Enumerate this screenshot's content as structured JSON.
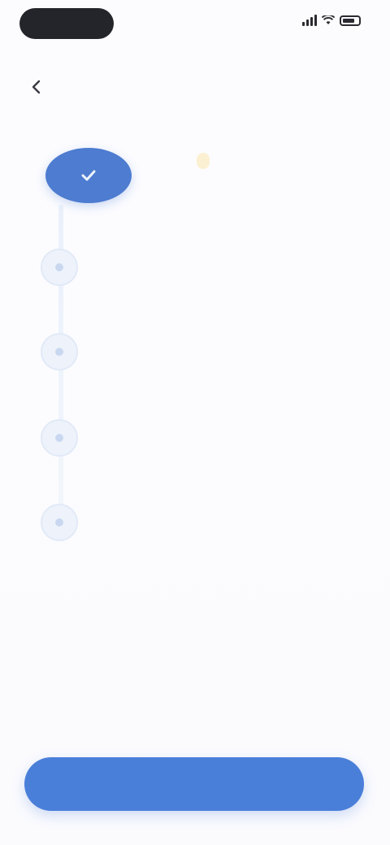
{
  "status_bar": {
    "time": ""
  },
  "nav": {
    "back_label": ""
  },
  "timeline": {
    "first_step": {
      "title": "",
      "badge": "",
      "subtitle": ""
    },
    "steps": [
      {
        "title": "",
        "subtitle": ""
      },
      {
        "title": "",
        "subtitle": ""
      },
      {
        "title": "",
        "subtitle": ""
      },
      {
        "title": "",
        "subtitle": ""
      }
    ]
  },
  "cta": {
    "label": ""
  },
  "colors": {
    "accent": "#4a7fd9",
    "badge_bg": "#fbf0d2",
    "background": "#fbfbfe"
  },
  "icons": {
    "back": "chevron-left-icon",
    "first_step": "check-icon",
    "signal": "signal-icon",
    "wifi": "wifi-icon",
    "battery": "battery-icon"
  }
}
